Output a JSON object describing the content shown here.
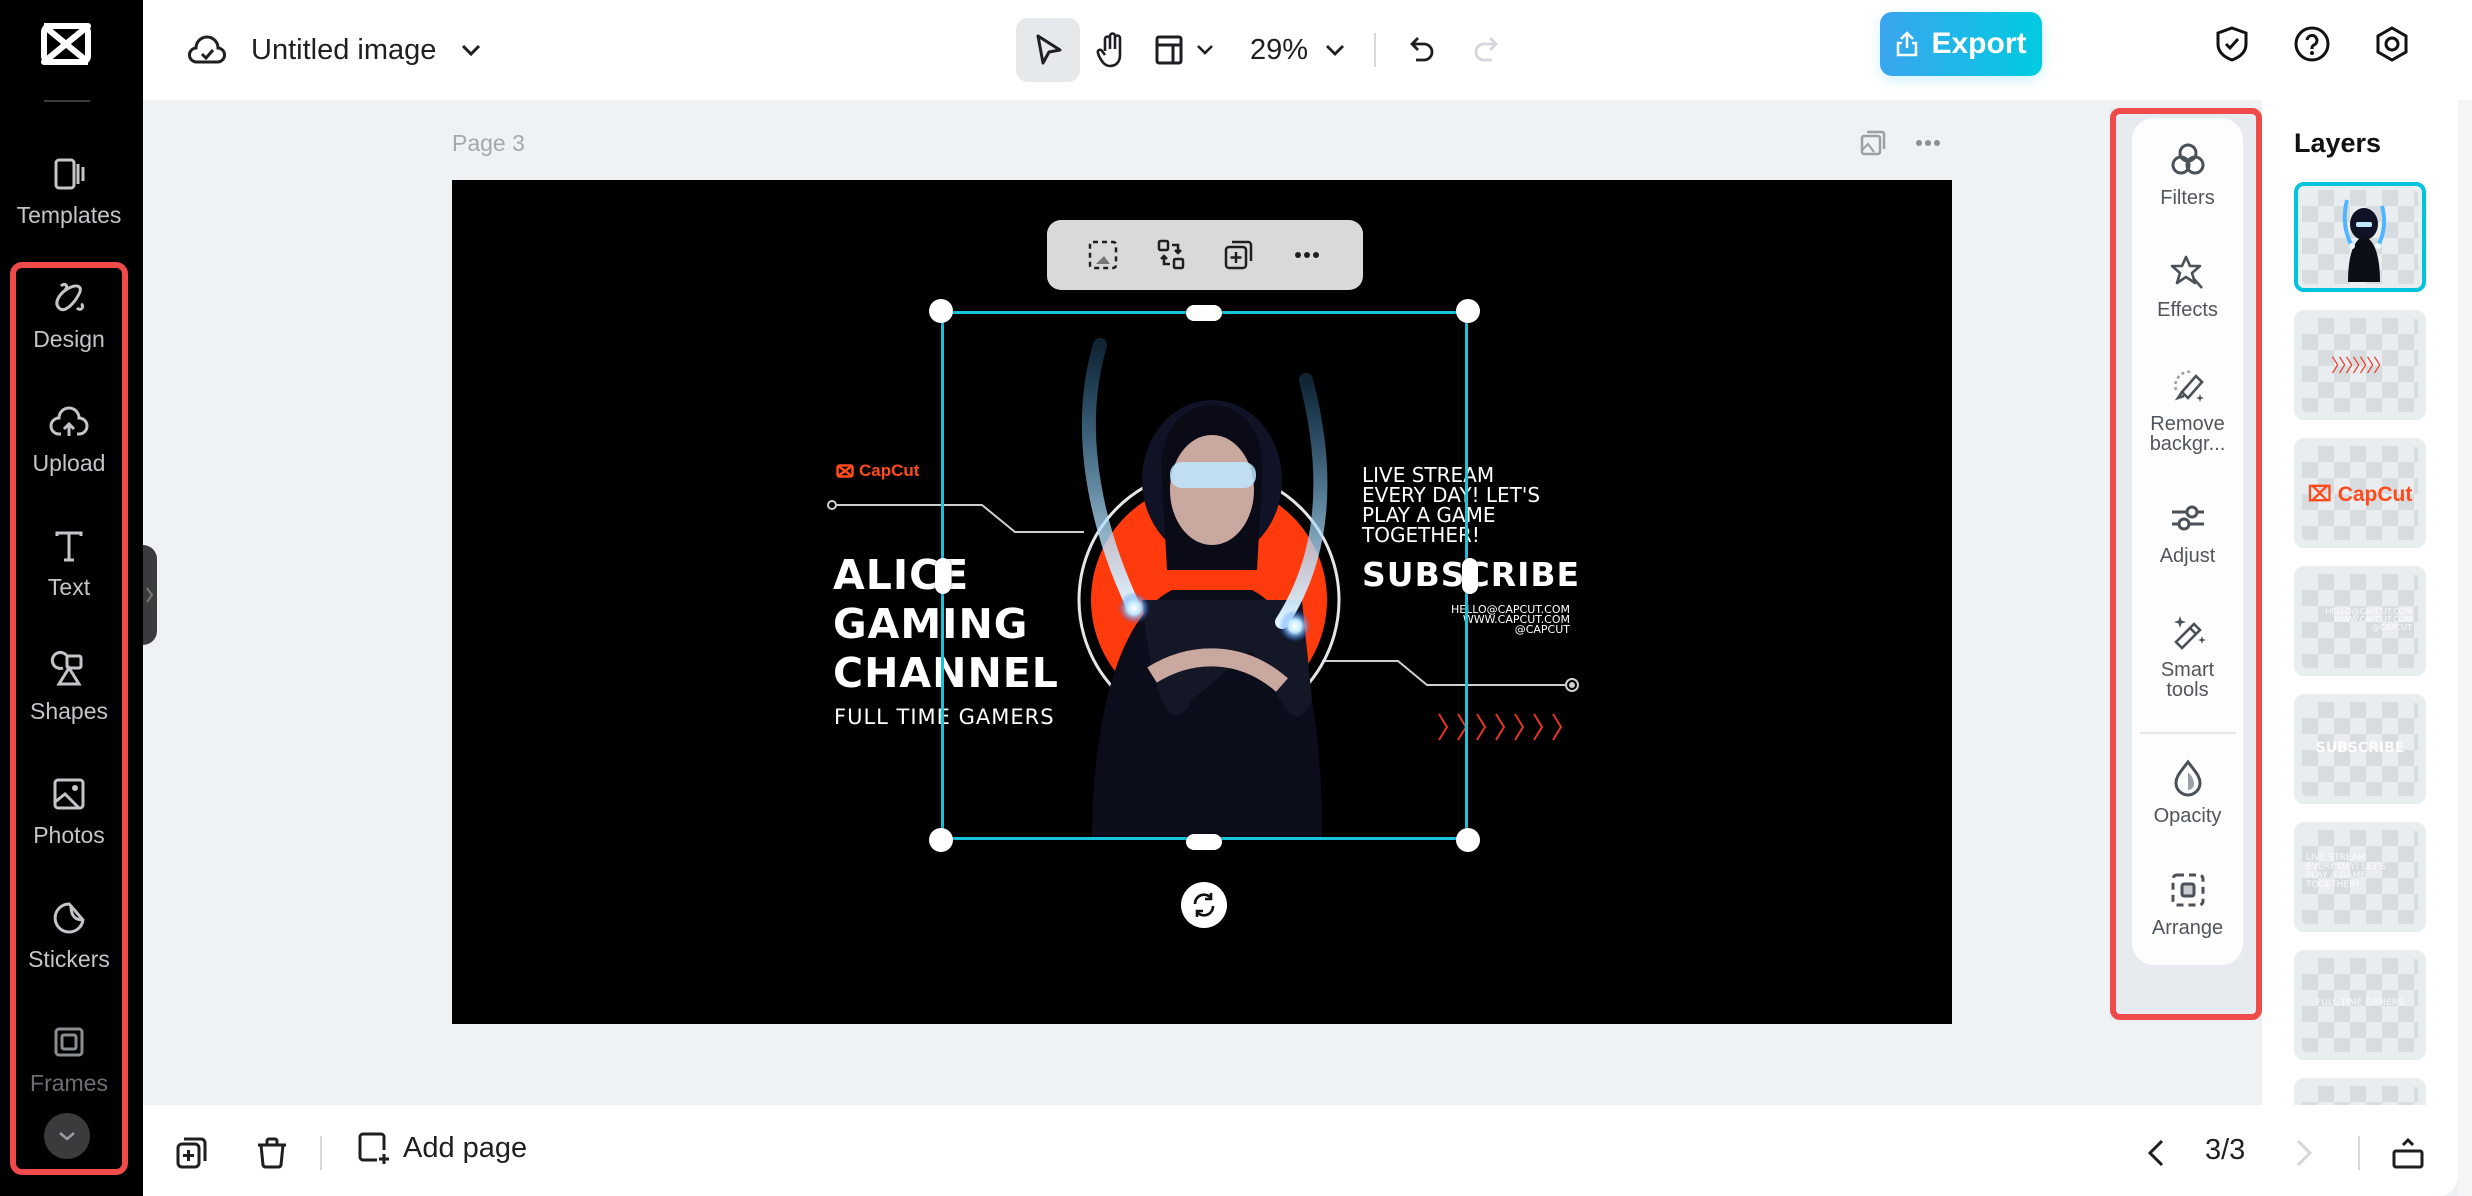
{
  "app": {
    "brand": "CapCut"
  },
  "header": {
    "doc_title": "Untitled image",
    "zoom": "29%",
    "export_label": "Export",
    "icons": [
      "cloud-saved-icon",
      "chevron-down-icon",
      "select-pointer-icon",
      "hand-pan-icon",
      "layout-icon",
      "undo-icon",
      "redo-icon",
      "shield-check-icon",
      "help-icon",
      "settings-hex-icon"
    ]
  },
  "sidebar": {
    "items": [
      {
        "label": "Templates",
        "icon": "templates-icon"
      },
      {
        "label": "Design",
        "icon": "design-icon"
      },
      {
        "label": "Upload",
        "icon": "upload-cloud-icon"
      },
      {
        "label": "Text",
        "icon": "text-icon"
      },
      {
        "label": "Shapes",
        "icon": "shapes-icon"
      },
      {
        "label": "Photos",
        "icon": "photos-icon"
      },
      {
        "label": "Stickers",
        "icon": "stickers-icon"
      },
      {
        "label": "Frames",
        "icon": "frames-icon"
      }
    ]
  },
  "workspace": {
    "page_label": "Page 3"
  },
  "design": {
    "brand_mark": "CapCut",
    "title": "ALICE\nGAMING\nCHANNEL",
    "subtitle": "FULL TIME GAMERS",
    "live_text": "LIVE STREAM\nEVERY DAY! LET'S\nPLAY A GAME\nTOGETHER!",
    "subscribe": "SUBSCRIBE",
    "contact": "HELLO@CAPCUT.COM\nWWW.CAPCUT.COM\n@CAPCUT",
    "accent_color": "#ff4a1c",
    "selection_color": "#18c3dc"
  },
  "tools": {
    "items": [
      {
        "label": "Filters",
        "icon": "filters-icon"
      },
      {
        "label": "Effects",
        "icon": "effects-star-icon"
      },
      {
        "label": "Remove backgr...",
        "icon": "remove-background-icon"
      },
      {
        "label": "Adjust",
        "icon": "adjust-sliders-icon"
      },
      {
        "label": "Smart tools",
        "icon": "magic-wand-icon"
      },
      {
        "label": "Opacity",
        "icon": "opacity-drop-icon"
      },
      {
        "label": "Arrange",
        "icon": "arrange-icon"
      }
    ]
  },
  "layers": {
    "title": "Layers",
    "items": [
      {
        "name": "person-image",
        "selected": true
      },
      {
        "name": "chevrons",
        "text": "〉〉〉〉〉〉〉"
      },
      {
        "name": "capcut-logo",
        "text": "CapCut"
      },
      {
        "name": "contact-text",
        "text": "HELLO@CAPCUT.COM\nWWW.CAPCUT.COM\n@CAPCUT"
      },
      {
        "name": "subscribe-text",
        "text": "SUBSCRIBE"
      },
      {
        "name": "live-text",
        "text": "LIVE STREAM\nEVERY DAY! LET'S\nPLAY A GAME\nTOGETHER!"
      },
      {
        "name": "subtitle-text",
        "text": "FULL TIME GAMERS"
      },
      {
        "name": "layer-8",
        "text": ""
      }
    ]
  },
  "footer": {
    "add_page_label": "Add page",
    "page_count": "3/3"
  }
}
